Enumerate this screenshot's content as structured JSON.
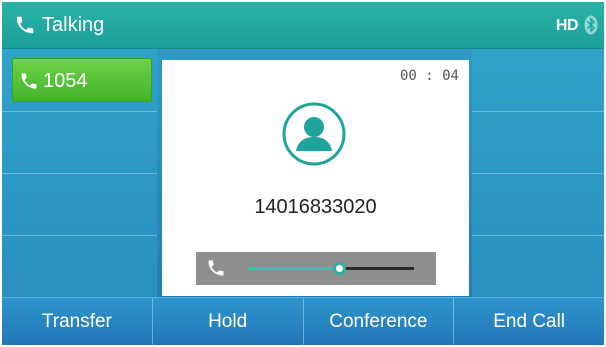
{
  "status_bar": {
    "title": "Talking",
    "hd_label": "HD",
    "phone_icon": "handset-icon",
    "bluetooth_icon": "bluetooth-icon"
  },
  "line_key": {
    "label": "1054",
    "icon": "handset-icon",
    "color": "#4cbf33"
  },
  "call": {
    "timer": "00 : 04",
    "number": "14016833020",
    "avatar_icon": "contact-avatar-icon",
    "volume_level": 0.55
  },
  "softkeys": [
    {
      "label": "Transfer"
    },
    {
      "label": "Hold"
    },
    {
      "label": "Conference"
    },
    {
      "label": "End Call"
    }
  ],
  "colors": {
    "accent": "#1fa39d",
    "background": "#2a8ebf",
    "card": "#ffffff",
    "volume_fill": "#35c3b4"
  }
}
